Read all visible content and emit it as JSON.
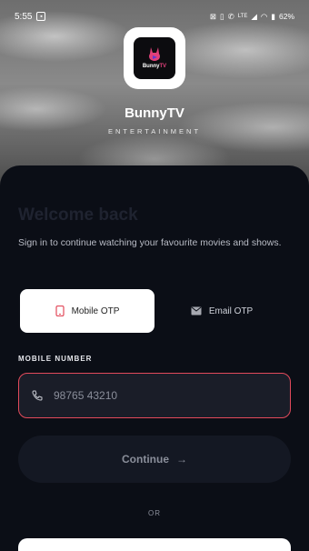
{
  "status_bar": {
    "time": "5:55",
    "notification_icon": "app-notification-icon",
    "icons": [
      "nfc-icon",
      "vibrate-icon",
      "call-icon",
      "lte-icon",
      "signal-icon",
      "wifi-icon",
      "battery-icon"
    ],
    "network_label": "LTE",
    "battery": "62%"
  },
  "brand": {
    "logo_text_a": "Bunny",
    "logo_text_b": "TV",
    "name": "BunnyTV",
    "subtitle": "ENTERTAINMENT",
    "accent_color": "#e0407a"
  },
  "auth": {
    "title": "Welcome back",
    "subtitle": "Sign in to continue watching your favourite movies and shows.",
    "tabs": [
      {
        "label": "Mobile OTP",
        "icon": "phone-icon",
        "active": true
      },
      {
        "label": "Email OTP",
        "icon": "mail-icon",
        "active": false
      }
    ],
    "field_label": "MOBILE NUMBER",
    "phone_placeholder": "98765 43210",
    "field_border_color": "#e24a5b",
    "continue_label": "Continue",
    "or_label": "OR"
  }
}
